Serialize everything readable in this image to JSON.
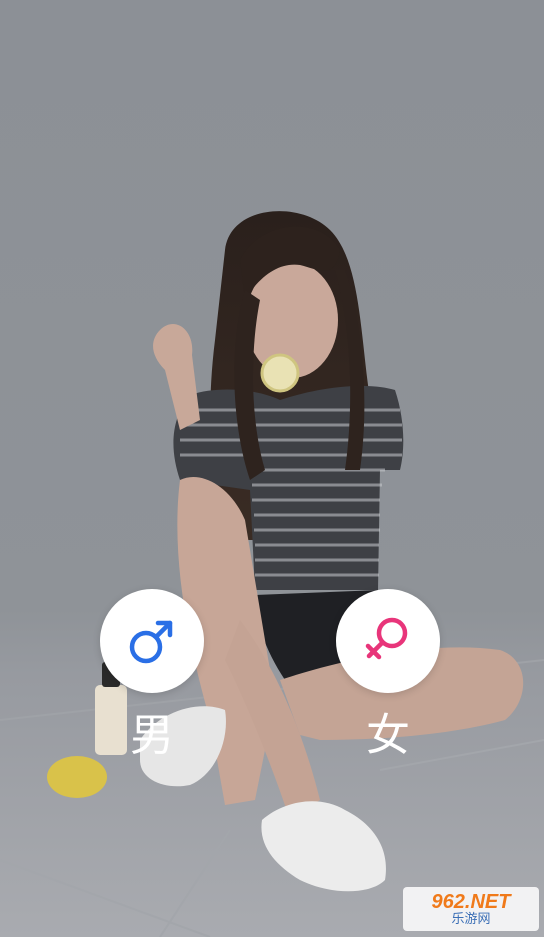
{
  "options": {
    "male": {
      "label": "男",
      "icon": "male-symbol-icon",
      "color": "#2a6fe6"
    },
    "female": {
      "label": "女",
      "icon": "female-symbol-icon",
      "color": "#e8357a"
    }
  },
  "watermark": {
    "brand": "962.NET",
    "sub": "乐游网"
  }
}
